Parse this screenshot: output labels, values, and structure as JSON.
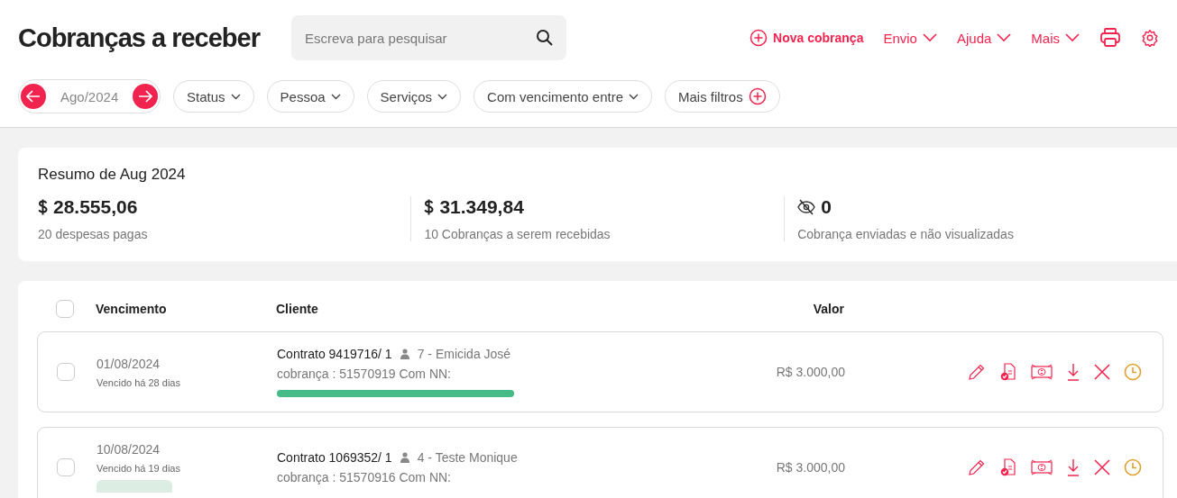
{
  "page_title": "Cobranças a receber",
  "search": {
    "placeholder": "Escreva para pesquisar"
  },
  "actions": [
    {
      "label": "Nova cobrança",
      "kind": "new"
    },
    {
      "label": "Envio",
      "kind": "menu"
    },
    {
      "label": "Ajuda",
      "kind": "menu"
    },
    {
      "label": "Mais",
      "kind": "menu"
    }
  ],
  "period": "Ago/2024",
  "filters": [
    {
      "label": "Status",
      "kind": "dropdown"
    },
    {
      "label": "Pessoa",
      "kind": "dropdown"
    },
    {
      "label": "Serviços",
      "kind": "dropdown"
    },
    {
      "label": "Com vencimento entre",
      "kind": "dropdown"
    },
    {
      "label": "Mais filtros",
      "kind": "add"
    }
  ],
  "summary": {
    "title": "Resumo de Aug 2024",
    "stats": [
      {
        "kind": "money",
        "value": "28.555,06",
        "caption": "20 despesas pagas"
      },
      {
        "kind": "money",
        "value": "31.349,84",
        "caption": "10 Cobranças a serem recebidas"
      },
      {
        "kind": "hidden",
        "value": "0",
        "caption": "Cobrança enviadas e não visualizadas"
      }
    ]
  },
  "table": {
    "columns": [
      "Vencimento",
      "Cliente",
      "Valor"
    ],
    "all_checked": false,
    "rows": [
      {
        "checked": false,
        "due": "01/08/2024",
        "overdue": "Vencido há 28 dias",
        "contract": "Contrato 9419716/ 1",
        "client": "7 - Emicida José",
        "charge": "cobrança : 51570919 Com NN:",
        "progress": {
          "level": 1
        },
        "tag": false,
        "amount": "R$ 3.000,00"
      },
      {
        "checked": false,
        "due": "10/08/2024",
        "overdue": "Vencido há 19 dias",
        "contract": "Contrato 1069352/ 1",
        "client": "4 - Teste Monique",
        "charge": "cobrança : 51570916 Com NN:",
        "tag": true,
        "amount": "R$ 3.000,00"
      }
    ]
  }
}
